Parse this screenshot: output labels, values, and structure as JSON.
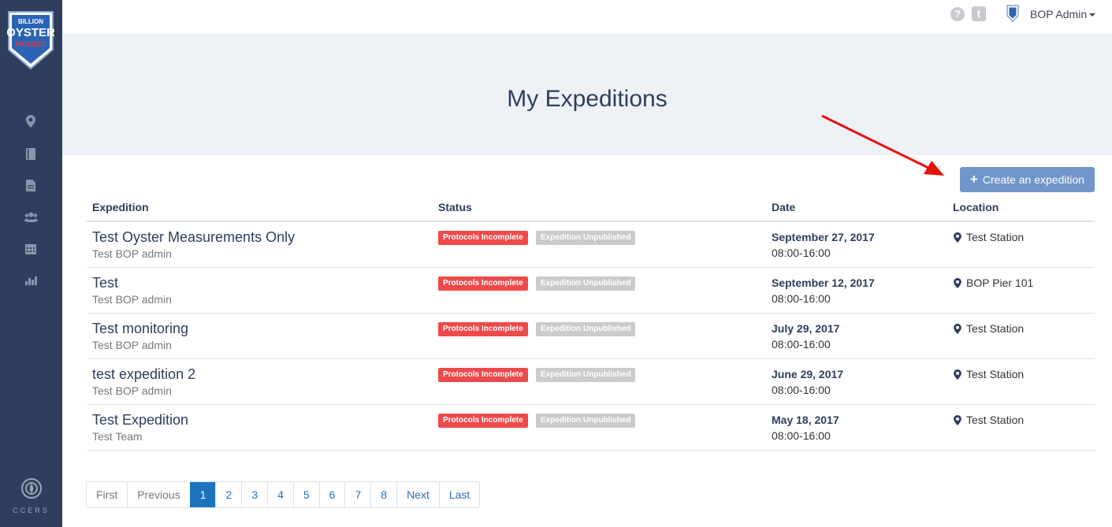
{
  "brand": {
    "logo_text_top": "BILLION",
    "logo_text_mid": "OYSTER",
    "logo_text_bottom": "PROJECT",
    "footer_label": "CCERS"
  },
  "sidebar": {
    "icons": [
      "map-marker-icon",
      "book-icon",
      "document-icon",
      "users-icon",
      "calendar-icon",
      "chart-icon"
    ]
  },
  "topbar": {
    "help_glyph": "?",
    "t_glyph": "t",
    "user_label": "BOP Admin"
  },
  "page": {
    "title": "My Expeditions",
    "create_button_label": "Create an expedition"
  },
  "table": {
    "headers": {
      "expedition": "Expedition",
      "status": "Status",
      "date": "Date",
      "location": "Location"
    },
    "rows": [
      {
        "name": "Test Oyster Measurements Only",
        "owner": "Test BOP admin",
        "status1": "Protocols Incomplete",
        "status2": "Expedition Unpublished",
        "date": "September 27, 2017",
        "time": "08:00-16:00",
        "location": "Test Station"
      },
      {
        "name": "Test",
        "owner": "Test BOP admin",
        "status1": "Protocols Incomplete",
        "status2": "Expedition Unpublished",
        "date": "September 12, 2017",
        "time": "08:00-16:00",
        "location": "BOP Pier 101"
      },
      {
        "name": "Test monitoring",
        "owner": "Test BOP admin",
        "status1": "Protocols Incomplete",
        "status2": "Expedition Unpublished",
        "date": "July 29, 2017",
        "time": "08:00-16:00",
        "location": "Test Station"
      },
      {
        "name": "test expedition 2",
        "owner": "Test BOP admin",
        "status1": "Protocols Incomplete",
        "status2": "Expedition Unpublished",
        "date": "June 29, 2017",
        "time": "08:00-16:00",
        "location": "Test Station"
      },
      {
        "name": "Test Expedition",
        "owner": "Test Team",
        "status1": "Protocols Incomplete",
        "status2": "Expedition Unpublished",
        "date": "May 18, 2017",
        "time": "08:00-16:00",
        "location": "Test Station"
      }
    ]
  },
  "pagination": {
    "first": "First",
    "previous": "Previous",
    "pages": [
      "1",
      "2",
      "3",
      "4",
      "5",
      "6",
      "7",
      "8"
    ],
    "current": "1",
    "next": "Next",
    "last": "Last"
  },
  "colors": {
    "sidebar_bg": "#2e3e5c",
    "accent_button": "#7095c9",
    "badge_incomplete": "#ef4a4a",
    "badge_unpublished": "#c9cbcd",
    "pager_active": "#1c74bd",
    "annotation_arrow": "#e8120c"
  }
}
